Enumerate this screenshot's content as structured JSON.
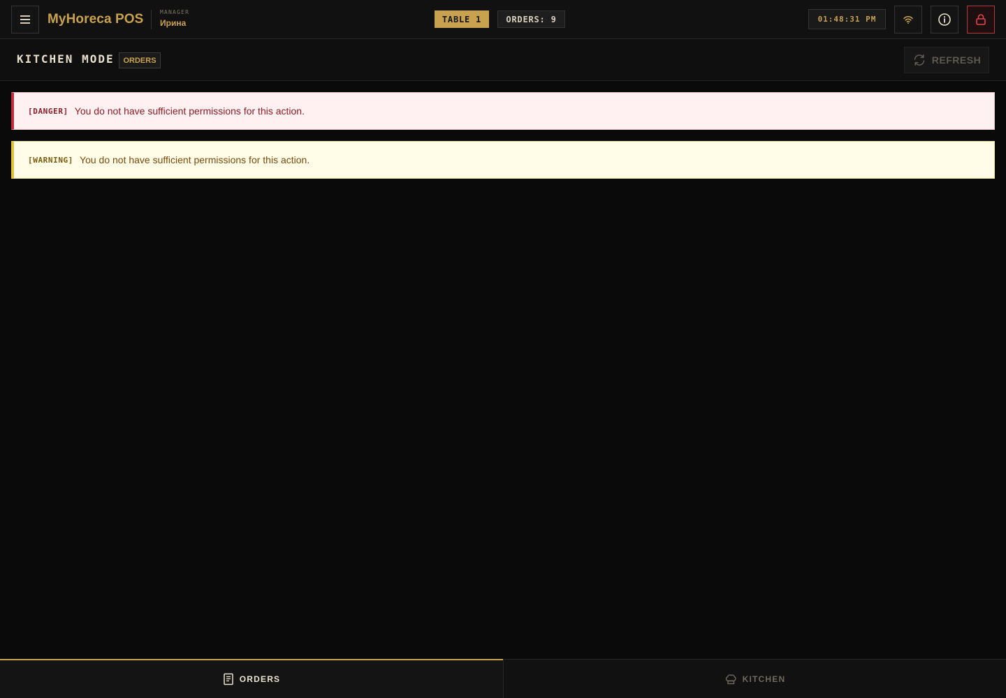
{
  "header": {
    "brand": "MyHoreca POS",
    "role_label": "MANAGER",
    "user_name": "Ирина",
    "table_badge": "TABLE 1",
    "orders_badge": "ORDERS: 9",
    "clock": "01:48:31 PM",
    "icons": {
      "menu": "hamburger-icon",
      "wifi": "wifi-icon",
      "info": "info-icon",
      "lock": "lock-icon"
    }
  },
  "subheader": {
    "title": "KITCHEN MODE",
    "tag": "ORDERS",
    "refresh_label": "REFRESH",
    "refresh_icon": "refresh-icon"
  },
  "alerts": [
    {
      "type": "danger",
      "tag": "[DANGER]",
      "message": "You do not have sufficient permissions for this action."
    },
    {
      "type": "warning",
      "tag": "[WARNING]",
      "message": "You do not have sufficient permissions for this action."
    }
  ],
  "bottom_nav": {
    "tabs": [
      {
        "label": "ORDERS",
        "icon": "receipt-icon",
        "active": true
      },
      {
        "label": "KITCHEN",
        "icon": "chef-hat-icon",
        "active": false
      }
    ]
  },
  "colors": {
    "accent": "#c9a24f",
    "background": "#0a0a0a",
    "danger": "#c0303c",
    "warning": "#e1c23b"
  }
}
